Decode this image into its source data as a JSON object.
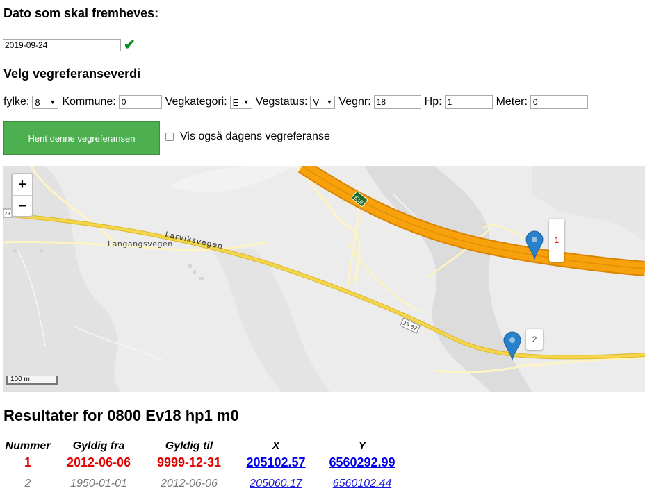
{
  "date_section": {
    "heading": "Dato som skal fremheves:",
    "date_value": "2019-09-24",
    "valid_icon": "checkmark-icon",
    "valid_color": "#0a8f20"
  },
  "vegref_section": {
    "heading": "Velg vegreferanseverdi",
    "fylke_label": "fylke:",
    "fylke_value": "8",
    "kommune_label": "Kommune:",
    "kommune_value": "0",
    "vegkategori_label": "Vegkategori:",
    "vegkategori_value": "E",
    "vegstatus_label": "Vegstatus:",
    "vegstatus_value": "V",
    "vegnr_label": "Vegnr:",
    "vegnr_value": "18",
    "hp_label": "Hp:",
    "hp_value": "1",
    "meter_label": "Meter:",
    "meter_value": "0"
  },
  "fetch_button": {
    "label": "Hent denne vegreferansen",
    "color": "#4caf50"
  },
  "show_current": {
    "label": "Vis også dagens vegreferanse",
    "checked": false
  },
  "map": {
    "zoom_in": "+",
    "zoom_out": "−",
    "road_labels": {
      "e18": "E18",
      "larviksvegen": "Larviksvegen",
      "langangsvegen": "Langangsvegen",
      "r2962": "29 62",
      "r29_edge": "29"
    },
    "markers": [
      {
        "label": "1",
        "color": "#e00000"
      },
      {
        "label": "2",
        "color": "#333333"
      }
    ],
    "scale_label": "100 m",
    "colors": {
      "highway": "#f7a10c",
      "main_road": "#f5d64a",
      "minor_road": "#fff4c0"
    }
  },
  "results": {
    "heading": "Resultater for 0800 Ev18 hp1 m0",
    "columns": [
      "Nummer",
      "Gyldig fra",
      "Gyldig til",
      "X",
      "Y"
    ],
    "rows": [
      {
        "nummer": "1",
        "gyldig_fra": "2012-06-06",
        "gyldig_til": "9999-12-31",
        "x": "205102.57",
        "y": "6560292.99"
      },
      {
        "nummer": "2",
        "gyldig_fra": "1950-01-01",
        "gyldig_til": "2012-06-06",
        "x": "205060.17",
        "y": "6560102.44"
      }
    ]
  }
}
